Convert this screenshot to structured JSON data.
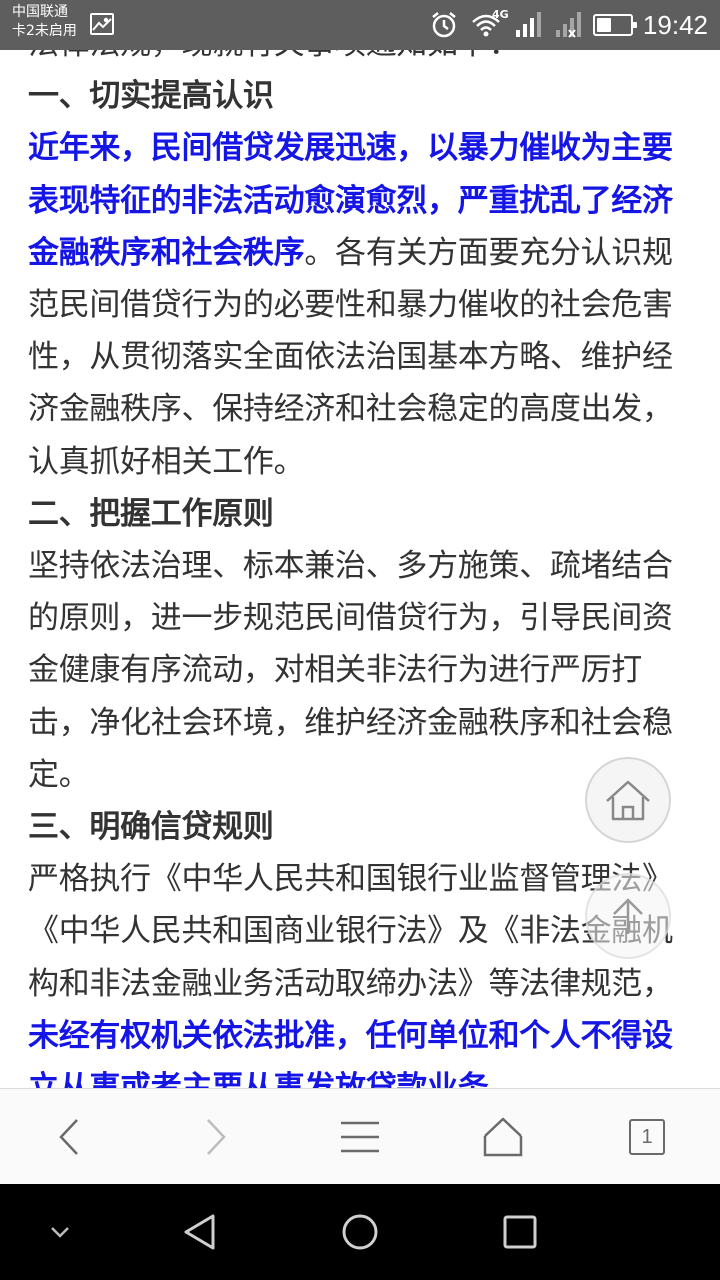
{
  "status_bar": {
    "carrier_line1": "中国联通",
    "carrier_line2": "卡2未启用",
    "network": "4G",
    "time": "19:42",
    "battery_level": 0.45
  },
  "article": {
    "p1": "法律法规，现就有关事项通知如下：",
    "h1": "一、切实提高认识",
    "p2_highlight": "近年来，民间借贷发展迅速，以暴力催收为主要表现特征的非法活动愈演愈烈，严重扰乱了经济金融秩序和社会秩序",
    "p2_rest": "。各有关方面要充分认识规范民间借贷行为的必要性和暴力催收的社会危害性，从贯彻落实全面依法治国基本方略、维护经济金融秩序、保持经济和社会稳定的高度出发，认真抓好相关工作。",
    "h2": "二、把握工作原则",
    "p3": "坚持依法治理、标本兼治、多方施策、疏堵结合的原则，进一步规范民间借贷行为，引导民间资金健康有序流动，对相关非法行为进行严厉打击，净化社会环境，维护经济金融秩序和社会稳定。",
    "h3": "三、明确信贷规则",
    "p4": "严格执行《中华人民共和国银行业监督管理法》《中华人民共和国商业银行法》及《非法金融机构和非法金融业务活动取缔办法》等法律规范，",
    "p4_highlight": "未经有权机关依法批准，任何单位和个人不得设立从事或者主要从事发放贷款业务"
  },
  "floating": {
    "home_icon": "home-outline-icon",
    "top_icon": "arrow-up-icon"
  },
  "toolbar": {
    "tab_count": "1",
    "icons": [
      "chevron-left-icon",
      "chevron-right-icon",
      "menu-icon",
      "home-icon",
      "tabs-icon"
    ]
  },
  "nav": {
    "icons": [
      "collapse-icon",
      "back-triangle-icon",
      "home-circle-icon",
      "recents-square-icon"
    ]
  },
  "colors": {
    "highlight": "#1515e6",
    "text": "#333333",
    "status_bar": "#5e5e5e",
    "nav_bar": "#000000"
  }
}
